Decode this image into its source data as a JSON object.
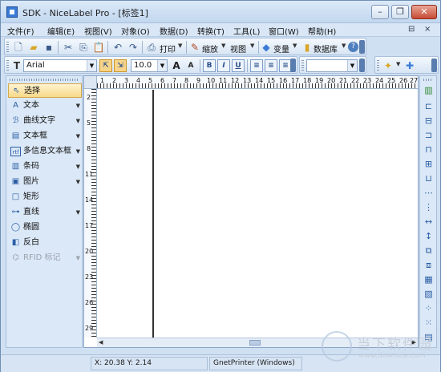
{
  "window": {
    "title": "SDK - NiceLabel Pro - [标签1]",
    "controls": {
      "minimize": "–",
      "restore": "❐",
      "close": "✕"
    }
  },
  "menu": {
    "items": [
      "文件(F)",
      "编辑(E)",
      "视图(V)",
      "对象(O)",
      "数据(D)",
      "转换(T)",
      "工具(L)",
      "窗口(W)",
      "帮助(H)"
    ],
    "mdi_restore": "⊟",
    "mdi_close": "×"
  },
  "toolbar_standard": {
    "print_label": "打印",
    "zoom_label": "缩放",
    "view_label": "视图",
    "variables_label": "变量",
    "database_label": "数据库",
    "help_glyph": "?"
  },
  "toolbar_format": {
    "font_icon_label": "T",
    "font_name": "Arial",
    "font_size": "10.0",
    "bold": "B",
    "italic": "I",
    "underline": "U",
    "grow": "A",
    "shrink": "A"
  },
  "tools": [
    {
      "label": "选择",
      "icon": "pointer-icon",
      "glyph": "⇖",
      "dropdown": false,
      "selected": true,
      "disabled": false
    },
    {
      "label": "文本",
      "icon": "text-icon",
      "glyph": "A",
      "dropdown": true,
      "selected": false,
      "disabled": false
    },
    {
      "label": "曲线文字",
      "icon": "curve-text-icon",
      "glyph": "ℬ",
      "dropdown": true,
      "selected": false,
      "disabled": false
    },
    {
      "label": "文本框",
      "icon": "text-box-icon",
      "glyph": "▤",
      "dropdown": true,
      "selected": false,
      "disabled": false
    },
    {
      "label": "多信息文本框",
      "icon": "rich-text-icon",
      "glyph": "rtf",
      "dropdown": true,
      "selected": false,
      "disabled": false
    },
    {
      "label": "条码",
      "icon": "barcode-icon",
      "glyph": "▥",
      "dropdown": true,
      "selected": false,
      "disabled": false
    },
    {
      "label": "图片",
      "icon": "picture-icon",
      "glyph": "▣",
      "dropdown": true,
      "selected": false,
      "disabled": false
    },
    {
      "label": "矩形",
      "icon": "rectangle-icon",
      "glyph": "□",
      "dropdown": false,
      "selected": false,
      "disabled": false
    },
    {
      "label": "直线",
      "icon": "line-icon",
      "glyph": "⊶",
      "dropdown": true,
      "selected": false,
      "disabled": false
    },
    {
      "label": "椭圆",
      "icon": "ellipse-icon",
      "glyph": "◯",
      "dropdown": false,
      "selected": false,
      "disabled": false
    },
    {
      "label": "反白",
      "icon": "inverse-icon",
      "glyph": "◧",
      "dropdown": false,
      "selected": false,
      "disabled": false
    },
    {
      "label": "RFID 标记",
      "icon": "rfid-icon",
      "glyph": "⌬",
      "dropdown": true,
      "selected": false,
      "disabled": true
    }
  ],
  "ruler": {
    "h_labels": [
      "1",
      "2",
      "3",
      "4",
      "5",
      "6",
      "7",
      "8",
      "9",
      "10",
      "11",
      "12",
      "13",
      "14",
      "15",
      "16",
      "17",
      "18",
      "19",
      "20",
      "21",
      "22",
      "23",
      "24",
      "25",
      "26",
      "27"
    ],
    "v_labels": [
      "2",
      "5",
      "8",
      "11",
      "14",
      "17",
      "20",
      "23",
      "26",
      "29"
    ]
  },
  "status": {
    "coords": "X: 20.38 Y:  2.14",
    "printer": "GnetPrinter (Windows)"
  },
  "watermark": {
    "text": "当下软件园",
    "url": "www.downxia.com"
  }
}
